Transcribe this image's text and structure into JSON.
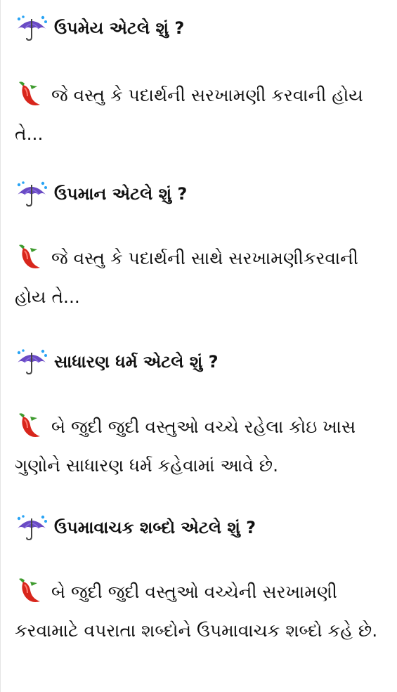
{
  "sections": [
    {
      "heading_icon": "umbrella-with-rain-icon",
      "heading": "ઉપમેય એટલે શું ?",
      "body_icon": "chili-pepper-icon",
      "body": "જે વસ્તુ કે પદાર્થની સરખામણી કરવાની હોય તે..."
    },
    {
      "heading_icon": "umbrella-with-rain-icon",
      "heading": "ઉપમાન એટલે શું ?",
      "body_icon": "chili-pepper-icon",
      "body": "જે વસ્તુ કે પદાર્થની સાથે સરખામણીકરવાની હોય તે..."
    },
    {
      "heading_icon": "umbrella-with-rain-icon",
      "heading": "સાધારણ ધર્મ એટલે શું ?",
      "body_icon": "chili-pepper-icon",
      "body": "બે જુદી જુદી વસ્તુઓ વચ્ચે રહેલા કોઇ ખાસ  ગુણોને સાધારણ ધર્મ કહેવામાં આવે છે."
    },
    {
      "heading_icon": "umbrella-with-rain-icon",
      "heading": "ઉપમાવાચક શબ્દો એટલે શું ?",
      "body_icon": "chili-pepper-icon",
      "body": "બે જુદી જુદી વસ્તુઓ વચ્ચેની સરખામણી કરવામાટે વપરાતા શબ્દોને ઉપમાવાચક શબ્દો કહે છે."
    }
  ]
}
